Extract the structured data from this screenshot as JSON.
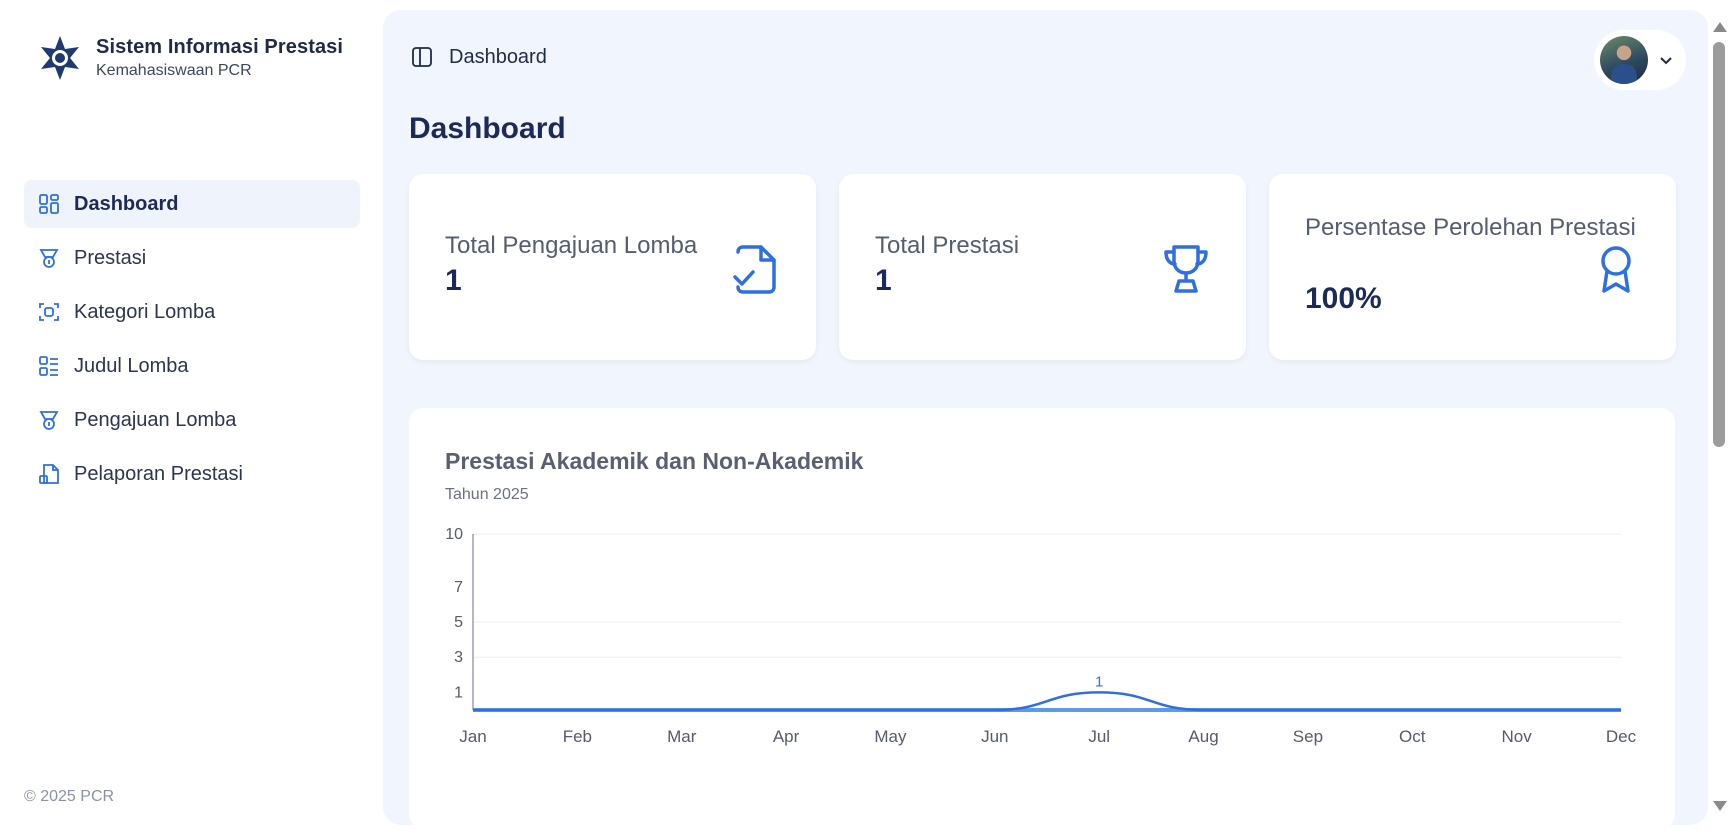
{
  "brand": {
    "title": "Sistem Informasi Prestasi",
    "subtitle": "Kemahasiswaan PCR"
  },
  "sidebar": {
    "items": [
      {
        "label": "Dashboard",
        "icon": "dashboard-grid-icon",
        "active": true
      },
      {
        "label": "Prestasi",
        "icon": "medal-icon",
        "active": false
      },
      {
        "label": "Kategori Lomba",
        "icon": "scan-category-icon",
        "active": false
      },
      {
        "label": "Judul Lomba",
        "icon": "list-icon",
        "active": false
      },
      {
        "label": "Pengajuan Lomba",
        "icon": "medal-icon",
        "active": false
      },
      {
        "label": "Pelaporan Prestasi",
        "icon": "file-report-icon",
        "active": false
      }
    ]
  },
  "footer": {
    "copyright": "© 2025 PCR"
  },
  "header": {
    "breadcrumb": "Dashboard"
  },
  "page": {
    "title": "Dashboard"
  },
  "cards": [
    {
      "label": "Total Pengajuan Lomba",
      "value": "1",
      "icon": "file-check-icon"
    },
    {
      "label": "Total Prestasi",
      "value": "1",
      "icon": "trophy-icon"
    },
    {
      "label": "Persentase Perolehan Prestasi",
      "value": "100%",
      "icon": "award-ribbon-icon"
    }
  ],
  "colors": {
    "accent": "#2f6fe0",
    "brand_navy": "#1c2a58",
    "sidebar_active_bg": "#eef3fc",
    "main_bg": "#f1f5fd"
  },
  "chart_data": {
    "type": "area",
    "title": "Prestasi Akademik dan Non-Akademik",
    "subtitle": "Tahun 2025",
    "categories": [
      "Jan",
      "Feb",
      "Mar",
      "Apr",
      "May",
      "Jun",
      "Jul",
      "Aug",
      "Sep",
      "Oct",
      "Nov",
      "Dec"
    ],
    "series": [
      {
        "values": [
          0,
          0,
          0,
          0,
          0,
          0,
          0,
          0,
          0,
          0,
          0,
          0
        ]
      },
      {
        "values": [
          0,
          0,
          0,
          0,
          0,
          0,
          1,
          0,
          0,
          0,
          0,
          0
        ]
      }
    ],
    "data_labels": [
      {
        "category": "Jul",
        "text": "1"
      }
    ],
    "y_ticks": [
      1,
      3,
      5,
      7,
      10
    ],
    "ylim": [
      0,
      10
    ],
    "grid": true,
    "series_colors": [
      "#5b9bef",
      "#2f6fe0"
    ]
  }
}
